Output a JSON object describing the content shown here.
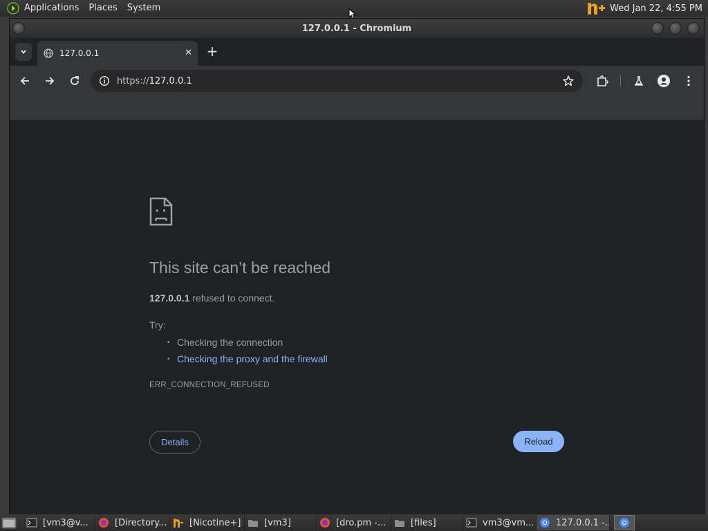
{
  "top_panel": {
    "menus": [
      "Applications",
      "Places",
      "System"
    ],
    "clock": "Wed Jan 22,  4:55 PM"
  },
  "window": {
    "title": "127.0.0.1 - Chromium"
  },
  "browser": {
    "tab_title": "127.0.0.1",
    "url_scheme": "https://",
    "url_host": "127.0.0.1"
  },
  "error_page": {
    "title": "This site can’t be reached",
    "host": "127.0.0.1",
    "description_suffix": " refused to connect.",
    "try_label": "Try:",
    "suggestions": [
      {
        "text": "Checking the connection",
        "link": false
      },
      {
        "text": "Checking the proxy and the firewall",
        "link": true
      }
    ],
    "error_code": "ERR_CONNECTION_REFUSED",
    "details_label": "Details",
    "reload_label": "Reload"
  },
  "taskbar": {
    "tasks": [
      {
        "label": "[vm3@v...",
        "icon": "terminal-icon"
      },
      {
        "label": "[Directory...",
        "icon": "firefox-icon"
      },
      {
        "label": "[Nicotine+]",
        "icon": "nicotine-icon"
      },
      {
        "label": "[vm3]",
        "icon": "folder-icon"
      },
      {
        "label": "[dro.pm -...",
        "icon": "firefox-icon"
      },
      {
        "label": "[files]",
        "icon": "folder-icon"
      },
      {
        "label": "vm3@vm...",
        "icon": "terminal-icon"
      },
      {
        "label": "127.0.0.1 -...",
        "icon": "chromium-icon"
      }
    ]
  },
  "colors": {
    "page_bg": "#202124",
    "link": "#8ab4f8",
    "text": "#9aa0a6"
  }
}
